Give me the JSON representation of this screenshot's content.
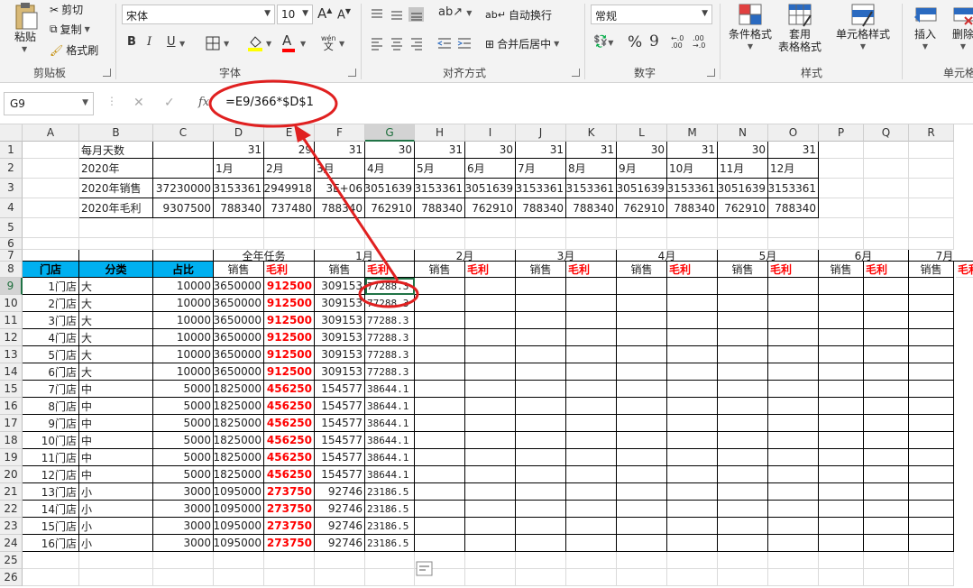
{
  "ribbon": {
    "clipboard": {
      "paste": "粘贴",
      "cut": "剪切",
      "copy": "复制",
      "format_painter": "格式刷",
      "label": "剪贴板"
    },
    "font": {
      "name": "宋体",
      "size": "10",
      "grow": "A",
      "shrink": "A",
      "bold": "B",
      "italic": "I",
      "underline": "U",
      "phonetic": "wén",
      "label": "字体"
    },
    "alignment": {
      "wrap": "自动换行",
      "merge": "合并后居中",
      "label": "对齐方式"
    },
    "number": {
      "format": "常规",
      "percent": "%",
      "comma": "9",
      "label": "数字"
    },
    "styles": {
      "conditional": "条件格式",
      "table_line1": "套用",
      "table_line2": "表格格式",
      "cell_styles": "单元格样式",
      "label": "样式"
    },
    "cells": {
      "insert": "插入",
      "delete": "删除",
      "label": "单元格"
    }
  },
  "formula_bar": {
    "name_box": "G9",
    "fx": "fx",
    "formula": "=E9/366*$D$1"
  },
  "columns": [
    "A",
    "B",
    "C",
    "D",
    "E",
    "F",
    "G",
    "H",
    "I",
    "J",
    "K",
    "L",
    "M",
    "N",
    "O",
    "P",
    "Q",
    "R"
  ],
  "rows": [
    "1",
    "2",
    "3",
    "4",
    "5",
    "6",
    "7",
    "8",
    "9",
    "10",
    "11",
    "12",
    "13",
    "14",
    "15",
    "16",
    "17",
    "18",
    "19",
    "20",
    "21",
    "22",
    "23",
    "24",
    "25",
    "26"
  ],
  "top_table": {
    "row1": {
      "label": "每月天数",
      "days": [
        "31",
        "29",
        "31",
        "30",
        "31",
        "30",
        "31",
        "31",
        "30",
        "31",
        "30",
        "31"
      ]
    },
    "row2": {
      "label": "2020年",
      "months": [
        "1月",
        "2月",
        "3月",
        "4月",
        "5月",
        "6月",
        "7月",
        "8月",
        "9月",
        "10月",
        "11月",
        "12月"
      ]
    },
    "row3": {
      "label": "2020年销售",
      "total": "37230000",
      "values": [
        "3153361",
        "2949918",
        "3E+06",
        "3051639",
        "3153361",
        "3051639",
        "3153361",
        "3153361",
        "3051639",
        "3153361",
        "3051639",
        "3153361"
      ]
    },
    "row4": {
      "label": "2020年毛利",
      "total": "9307500",
      "values": [
        "788340",
        "737480",
        "788340",
        "762910",
        "788340",
        "762910",
        "788340",
        "788340",
        "762910",
        "788340",
        "762910",
        "788340"
      ]
    }
  },
  "main_table": {
    "group_headers": [
      "全年任务",
      "1月",
      "2月",
      "3月",
      "4月",
      "5月",
      "6月",
      "7月"
    ],
    "headers": {
      "store": "门店",
      "category": "分类",
      "ratio": "占比",
      "sales": "销售",
      "profit": "毛利"
    },
    "rows": [
      [
        "1门店",
        "大",
        "10000",
        "3650000",
        "912500",
        "309153",
        "77288.3"
      ],
      [
        "2门店",
        "大",
        "10000",
        "3650000",
        "912500",
        "309153",
        "77288.3"
      ],
      [
        "3门店",
        "大",
        "10000",
        "3650000",
        "912500",
        "309153",
        "77288.3"
      ],
      [
        "4门店",
        "大",
        "10000",
        "3650000",
        "912500",
        "309153",
        "77288.3"
      ],
      [
        "5门店",
        "大",
        "10000",
        "3650000",
        "912500",
        "309153",
        "77288.3"
      ],
      [
        "6门店",
        "大",
        "10000",
        "3650000",
        "912500",
        "309153",
        "77288.3"
      ],
      [
        "7门店",
        "中",
        "5000",
        "1825000",
        "456250",
        "154577",
        "38644.1"
      ],
      [
        "8门店",
        "中",
        "5000",
        "1825000",
        "456250",
        "154577",
        "38644.1"
      ],
      [
        "9门店",
        "中",
        "5000",
        "1825000",
        "456250",
        "154577",
        "38644.1"
      ],
      [
        "10门店",
        "中",
        "5000",
        "1825000",
        "456250",
        "154577",
        "38644.1"
      ],
      [
        "11门店",
        "中",
        "5000",
        "1825000",
        "456250",
        "154577",
        "38644.1"
      ],
      [
        "12门店",
        "中",
        "5000",
        "1825000",
        "456250",
        "154577",
        "38644.1"
      ],
      [
        "13门店",
        "小",
        "3000",
        "1095000",
        "273750",
        "92746",
        "23186.5"
      ],
      [
        "14门店",
        "小",
        "3000",
        "1095000",
        "273750",
        "92746",
        "23186.5"
      ],
      [
        "15门店",
        "小",
        "3000",
        "1095000",
        "273750",
        "92746",
        "23186.5"
      ],
      [
        "16门店",
        "小",
        "3000",
        "1095000",
        "273750",
        "92746",
        "23186.5"
      ]
    ]
  },
  "colors": {
    "header_blue": "#00b0f0",
    "profit_red": "#ff0000",
    "annotation_red": "#e02020",
    "excel_green": "#217346"
  }
}
